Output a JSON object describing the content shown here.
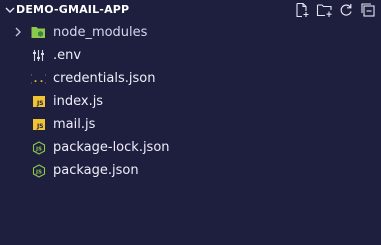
{
  "explorer": {
    "title": "DEMO-GMAIL-APP",
    "actions": [
      {
        "name": "new-file-icon",
        "label": "New File"
      },
      {
        "name": "new-folder-icon",
        "label": "New Folder"
      },
      {
        "name": "refresh-icon",
        "label": "Refresh Explorer"
      },
      {
        "name": "collapse-all-icon",
        "label": "Collapse Folders"
      }
    ]
  },
  "tree": {
    "items": [
      {
        "label": "node_modules",
        "type": "folder",
        "icon": "node-folder-icon",
        "expanded": false
      },
      {
        "label": ".env",
        "type": "file",
        "icon": "env-settings-icon"
      },
      {
        "label": "credentials.json",
        "type": "file",
        "icon": "json-braces-icon"
      },
      {
        "label": "index.js",
        "type": "file",
        "icon": "js-icon",
        "badge": "JS"
      },
      {
        "label": "mail.js",
        "type": "file",
        "icon": "js-icon",
        "badge": "JS"
      },
      {
        "label": "package-lock.json",
        "type": "file",
        "icon": "nodejs-icon"
      },
      {
        "label": "package.json",
        "type": "file",
        "icon": "nodejs-icon"
      }
    ]
  },
  "colors": {
    "background": "#1e1e3f",
    "text": "#eeeef8",
    "js_badge": "#f1c232",
    "json_braces": "#f1c232",
    "node_green": "#8cc84b"
  }
}
